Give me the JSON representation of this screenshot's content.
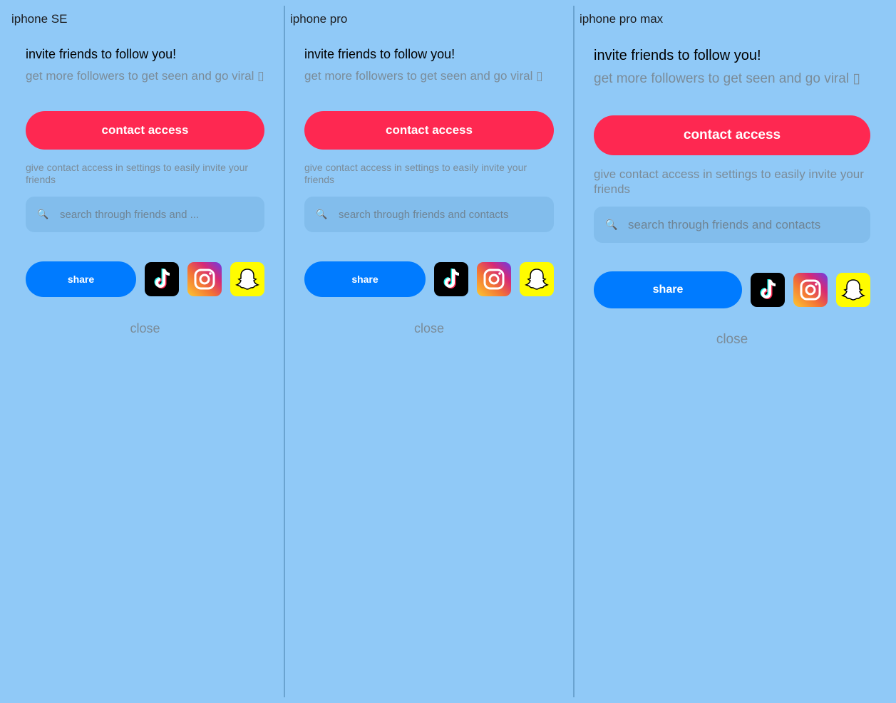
{
  "devices": [
    {
      "label": "iphone SE",
      "title": "invite friends to follow you!",
      "subtitle": "get more followers to get seen and go viral ▯",
      "contact_button": "contact access",
      "hint": "give contact access in settings to easily invite your friends",
      "search_placeholder": "search through friends and ...",
      "share_button": "share",
      "close": "close"
    },
    {
      "label": "iphone pro",
      "title": "invite friends to follow you!",
      "subtitle": "get more followers to get seen and go viral ▯",
      "contact_button": "contact access",
      "hint": "give contact access in settings to easily invite your friends",
      "search_placeholder": "search through friends and contacts",
      "share_button": "share",
      "close": "close"
    },
    {
      "label": "iphone pro max",
      "title": "invite friends to follow you!",
      "subtitle": "get more followers to get seen and go viral ▯",
      "contact_button": "contact access",
      "hint": "give contact access in settings to easily invite your friends",
      "search_placeholder": "search through friends and contacts",
      "share_button": "share",
      "close": "close"
    }
  ],
  "icons": {
    "search": "search-icon",
    "tiktok": "tiktok-icon",
    "instagram": "instagram-icon",
    "snapchat": "snapchat-icon"
  },
  "colors": {
    "background": "#90c9f7",
    "contact_button": "#fe2851",
    "share_button": "#007bff",
    "search_field": "#82bdec",
    "muted_text": "#7b8c99"
  }
}
